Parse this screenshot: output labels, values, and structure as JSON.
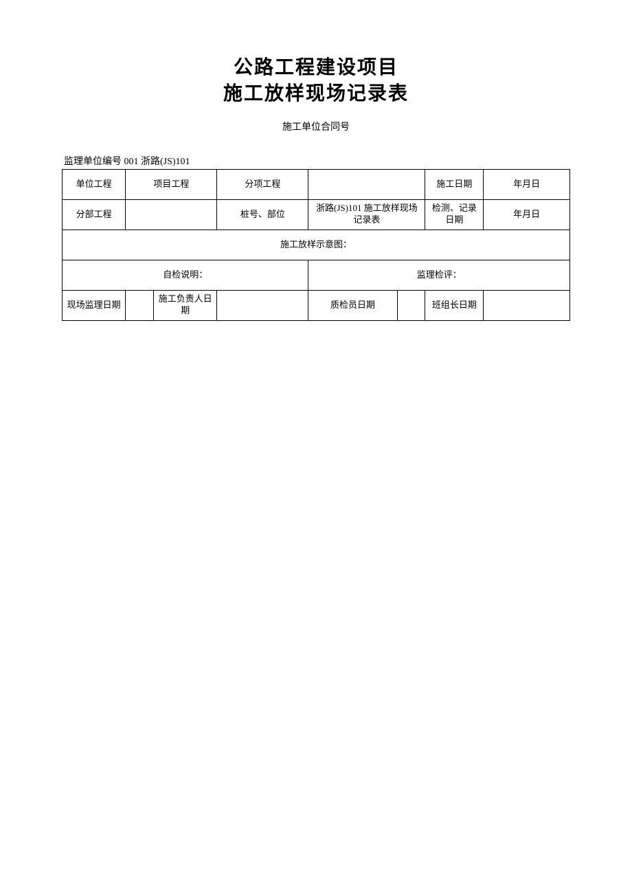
{
  "title_line1": "公路工程建设项目",
  "title_line2": "施工放样现场记录表",
  "subtitle": "施工单位合同号",
  "supervisor_line": "监理单位编号 001 浙路(JS)101",
  "labels": {
    "unit_project": "单位工程",
    "item_project": "项目工程",
    "sub_item_project": "分项工程",
    "construction_date": "施工日期",
    "date_value": "年月日",
    "sub_project": "分部工程",
    "pile_position": "桩号、部位",
    "zhelu_record": "浙路(JS)101 施工放样现场记录表",
    "inspection_record_date": "检测、记录日期",
    "diagram_title": "施工放样示意图：",
    "self_check": "自检说明：",
    "supervisor_check": "监理检评：",
    "site_supervisor_date": "现场监理日期",
    "construction_leader_date": "施工负责人日期",
    "qc_date": "质检员日期",
    "team_leader_date": "班组长日期"
  }
}
